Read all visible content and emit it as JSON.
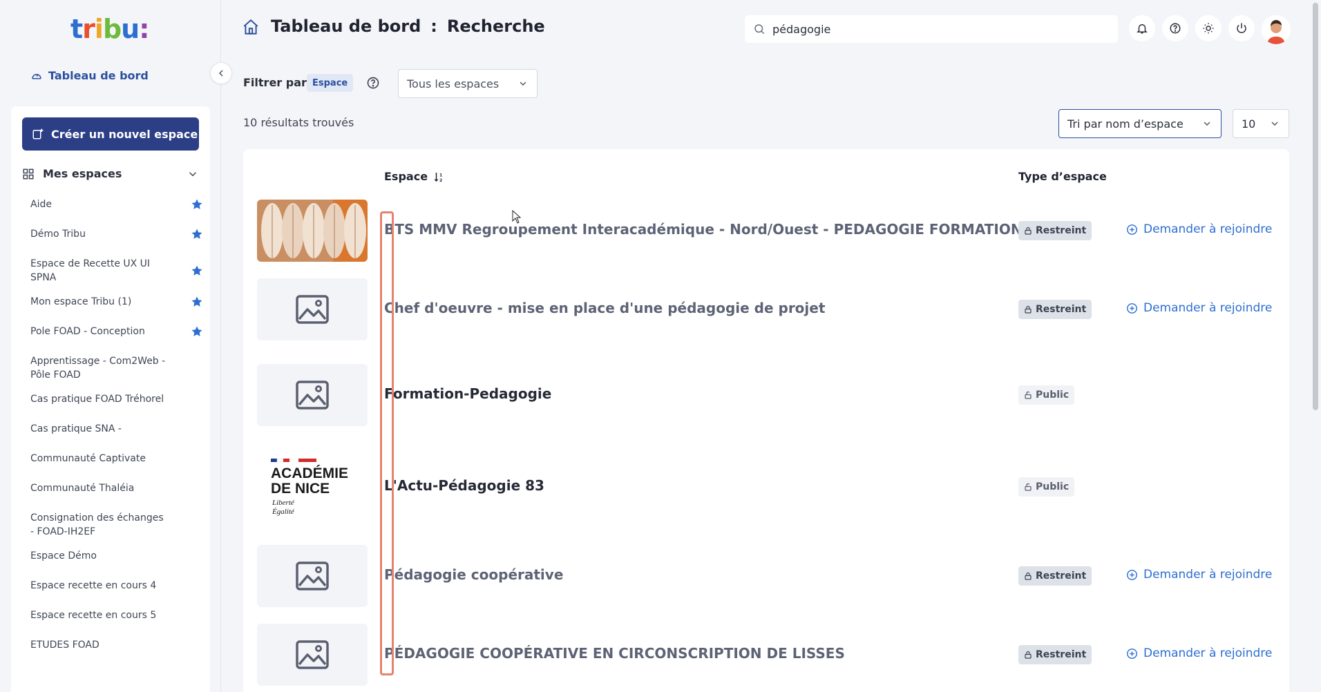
{
  "sidebar": {
    "logo_text": "tribu:",
    "dashboard_link": "Tableau de bord",
    "create_button": "Créer un nouvel espace",
    "my_spaces_label": "Mes espaces",
    "spaces": [
      {
        "name": "Aide",
        "starred": true
      },
      {
        "name": "Démo Tribu",
        "starred": true
      },
      {
        "name": "Espace de Recette UX UI SPNA",
        "starred": true
      },
      {
        "name": "Mon espace Tribu (1)",
        "starred": true
      },
      {
        "name": "Pole FOAD - Conception",
        "starred": true
      },
      {
        "name": "Apprentissage - Com2Web - Pôle FOAD",
        "starred": false
      },
      {
        "name": "Cas pratique FOAD Tréhorel",
        "starred": false
      },
      {
        "name": "Cas pratique SNA -",
        "starred": false
      },
      {
        "name": "Communauté Captivate",
        "starred": false
      },
      {
        "name": "Communauté Thaléia",
        "starred": false
      },
      {
        "name": "Consignation des échanges - FOAD-IH2EF",
        "starred": false
      },
      {
        "name": "Espace Démo",
        "starred": false
      },
      {
        "name": "Espace recette en cours 4",
        "starred": false
      },
      {
        "name": "Espace recette en cours 5",
        "starred": false
      },
      {
        "name": "ETUDES FOAD",
        "starred": false
      }
    ]
  },
  "header": {
    "title_part1": "Tableau de bord",
    "separator": ":",
    "title_part2": "Recherche",
    "search_value": "pédagogie"
  },
  "filters": {
    "label": "Filtrer par:",
    "chip": "Espace",
    "spaces_select": "Tous les espaces",
    "sort_select": "Tri par nom d’espace",
    "per_page": "10",
    "results_count": "10 résultats trouvés"
  },
  "table": {
    "col_space": "Espace",
    "col_type": "Type d’espace",
    "rows": [
      {
        "title": "BTS MMV Regroupement Interacadémique - Nord/Ouest - PEDAGOGIE FORMATION",
        "type": "Restreint",
        "access": "restricted",
        "thumb": "photo",
        "join": "Demander à rejoindre"
      },
      {
        "title": "Chef d'oeuvre - mise en place d'une pédagogie de projet",
        "type": "Restreint",
        "access": "restricted",
        "thumb": "placeholder",
        "join": "Demander à rejoindre"
      },
      {
        "title": "Formation-Pedagogie",
        "type": "Public",
        "access": "public",
        "thumb": "placeholder",
        "join": ""
      },
      {
        "title": "L'Actu-Pédagogie 83",
        "type": "Public",
        "access": "public",
        "thumb": "academie",
        "join": ""
      },
      {
        "title": "Pédagogie coopérative",
        "type": "Restreint",
        "access": "restricted",
        "thumb": "placeholder",
        "join": "Demander à rejoindre"
      },
      {
        "title": "PÉDAGOGIE COOPÉRATIVE EN CIRCONSCRIPTION DE LISSES",
        "type": "Restreint",
        "access": "restricted",
        "thumb": "placeholder",
        "join": "Demander à rejoindre"
      }
    ],
    "academie_logo": {
      "line1": "ACADÉMIE",
      "line2": "DE NICE",
      "line3": "Liberté",
      "line4": "Égalité"
    }
  },
  "colors": {
    "primary": "#2c3e86",
    "link": "#2c6ed1",
    "highlight": "#e5826f"
  }
}
